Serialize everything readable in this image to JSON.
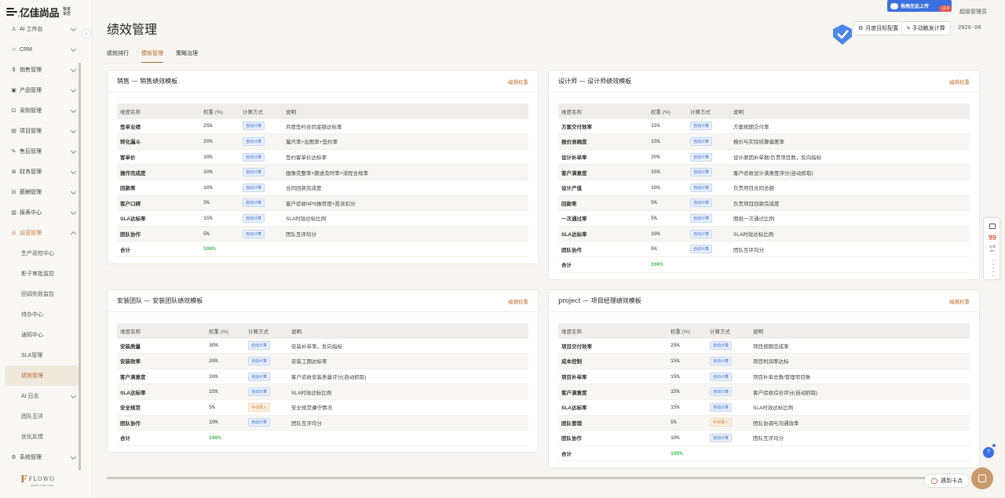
{
  "brand": {
    "logo_text": "亿佳尚品",
    "logo_small": "整装家居",
    "logo_sub": "EJIASANGPN"
  },
  "sidebar": {
    "items": [
      {
        "label": "AI 工作台",
        "icon": "robot-icon"
      },
      {
        "label": "CRM",
        "icon": "people-icon"
      },
      {
        "label": "销售管理",
        "icon": "sales-icon"
      },
      {
        "label": "产品管理",
        "icon": "box-icon"
      },
      {
        "label": "采购管理",
        "icon": "cart-icon"
      },
      {
        "label": "项目管理",
        "icon": "project-icon"
      },
      {
        "label": "售后管理",
        "icon": "wrench-icon"
      },
      {
        "label": "财务管理",
        "icon": "finance-icon"
      },
      {
        "label": "薪酬管理",
        "icon": "salary-icon"
      },
      {
        "label": "报表中心",
        "icon": "chart-icon"
      },
      {
        "label": "运营管理",
        "icon": "operation-icon"
      }
    ],
    "sub_items": [
      {
        "label": "生产巡检中心"
      },
      {
        "label": "影子审批监控"
      },
      {
        "label": "回调失败监控"
      },
      {
        "label": "待办中心"
      },
      {
        "label": "通知中心"
      },
      {
        "label": "SLA管理"
      },
      {
        "label": "绩效管理"
      },
      {
        "label": "AI 日志"
      },
      {
        "label": "团队互评"
      },
      {
        "label": "优化反馈"
      }
    ],
    "bottom_item": {
      "label": "系统管理",
      "icon": "settings-icon"
    },
    "footer_logo": {
      "mark": "F",
      "text": "FLOWO",
      "sub": "SMART HOME CARE"
    }
  },
  "header": {
    "page_title": "绩效管理",
    "upload_label": "拖拽至此上传",
    "badge": "12.9",
    "admin": "超级管理员",
    "btn_monthly": "月度目标配置",
    "btn_manual": "手动触发计算",
    "date": "2026-08"
  },
  "tabs": [
    {
      "label": "绩效排行"
    },
    {
      "label": "模板管理"
    },
    {
      "label": "策略治理"
    }
  ],
  "table_headers": {
    "name": "维度名称",
    "weight": "权重 (%)",
    "method": "计算方式",
    "desc": "说明"
  },
  "edit_label": "编辑权重",
  "total_label": "合计",
  "cards": [
    {
      "title": "销售 — 销售绩效模板",
      "rows": [
        {
          "name": "签单业绩",
          "weight": "25%",
          "method": "自动计算",
          "desc": "月度签约合同金额达标率"
        },
        {
          "name": "转化漏斗",
          "weight": "20%",
          "method": "自动计算",
          "desc": "量尺率+出图率+签约率"
        },
        {
          "name": "客单价",
          "weight": "10%",
          "method": "自动计算",
          "desc": "签约客单价达标率"
        },
        {
          "name": "操作完成度",
          "weight": "10%",
          "method": "自动计算",
          "desc": "画像完整率+跟进及时率+流程合规率"
        },
        {
          "name": "回款率",
          "weight": "10%",
          "method": "自动计算",
          "desc": "合同回款完成度"
        },
        {
          "name": "客户口碑",
          "weight": "5%",
          "method": "自动计算",
          "desc": "客户验收NPS推荐度+投诉扣分"
        },
        {
          "name": "SLA达标率",
          "weight": "15%",
          "method": "自动计算",
          "desc": "SLA时效达标比例"
        },
        {
          "name": "团队协作",
          "weight": "5%",
          "method": "自动计算",
          "desc": "团队互评均分"
        }
      ],
      "total": "100%"
    },
    {
      "title": "设计师 — 设计师绩效模板",
      "rows": [
        {
          "name": "方案交付效率",
          "weight": "15%",
          "method": "自动计算",
          "desc": "方案按期交付率"
        },
        {
          "name": "报价准确度",
          "weight": "15%",
          "method": "自动计算",
          "desc": "报价与实际结算偏差率"
        },
        {
          "name": "设计补单率",
          "weight": "20%",
          "method": "自动计算",
          "desc": "设计原因补单数/负责项目数，反向指标"
        },
        {
          "name": "客户满意度",
          "weight": "15%",
          "method": "自动计算",
          "desc": "客户验收设计满意度评分(自动抓取)"
        },
        {
          "name": "设计产值",
          "weight": "10%",
          "method": "自动计算",
          "desc": "负责项目合同总额"
        },
        {
          "name": "回款率",
          "weight": "5%",
          "method": "自动计算",
          "desc": "负责项目回款完成度"
        },
        {
          "name": "一次通过率",
          "weight": "5%",
          "method": "自动计算",
          "desc": "图纸一次通过比例"
        },
        {
          "name": "SLA达标率",
          "weight": "10%",
          "method": "自动计算",
          "desc": "SLA时效达标比例"
        },
        {
          "name": "团队协作",
          "weight": "5%",
          "method": "自动计算",
          "desc": "团队互评均分"
        }
      ],
      "total": "100%"
    },
    {
      "title": "安装团队 — 安装团队绩效模板",
      "rows": [
        {
          "name": "安装质量",
          "weight": "30%",
          "method": "自动计算",
          "desc": "安装补单率，反向指标"
        },
        {
          "name": "安装效率",
          "weight": "20%",
          "method": "自动计算",
          "desc": "安装工期达标率"
        },
        {
          "name": "客户满意度",
          "weight": "20%",
          "method": "自动计算",
          "desc": "客户验收安装质量评分(自动抓取)"
        },
        {
          "name": "SLA达标率",
          "weight": "15%",
          "method": "自动计算",
          "desc": "SLA时效达标比例"
        },
        {
          "name": "安全规范",
          "weight": "5%",
          "method": "手动录入",
          "desc": "安全规范遵守情况"
        },
        {
          "name": "团队协作",
          "weight": "10%",
          "method": "自动计算",
          "desc": "团队互评均分"
        }
      ],
      "total": "100%"
    },
    {
      "title": "project — 项目经理绩效模板",
      "rows": [
        {
          "name": "项目交付效率",
          "weight": "25%",
          "method": "自动计算",
          "desc": "项目按期完成率"
        },
        {
          "name": "成本控制",
          "weight": "15%",
          "method": "自动计算",
          "desc": "项目利润率达标"
        },
        {
          "name": "项目补单率",
          "weight": "15%",
          "method": "自动计算",
          "desc": "项目补单总数/管理项目数"
        },
        {
          "name": "客户满意度",
          "weight": "15%",
          "method": "自动计算",
          "desc": "客户验收综合评分(自动抓取)"
        },
        {
          "name": "SLA达标率",
          "weight": "15%",
          "method": "自动计算",
          "desc": "SLA时效达标比例"
        },
        {
          "name": "团队管理",
          "weight": "5%",
          "method": "手动录入",
          "desc": "团队协调与沟通效率"
        },
        {
          "name": "团队协作",
          "weight": "10%",
          "method": "自动计算",
          "desc": "团队互评均分"
        }
      ],
      "total": "100%"
    }
  ],
  "float_panel": {
    "num": "99",
    "line1": "分享",
    "line2": "99+"
  },
  "meet_label": "遇到卡点",
  "colors": {
    "accent": "#c57b3c",
    "total_green": "#3dbb4d",
    "auto_blue": "#3a6fc8",
    "brand_blue": "#3b6fe0"
  }
}
